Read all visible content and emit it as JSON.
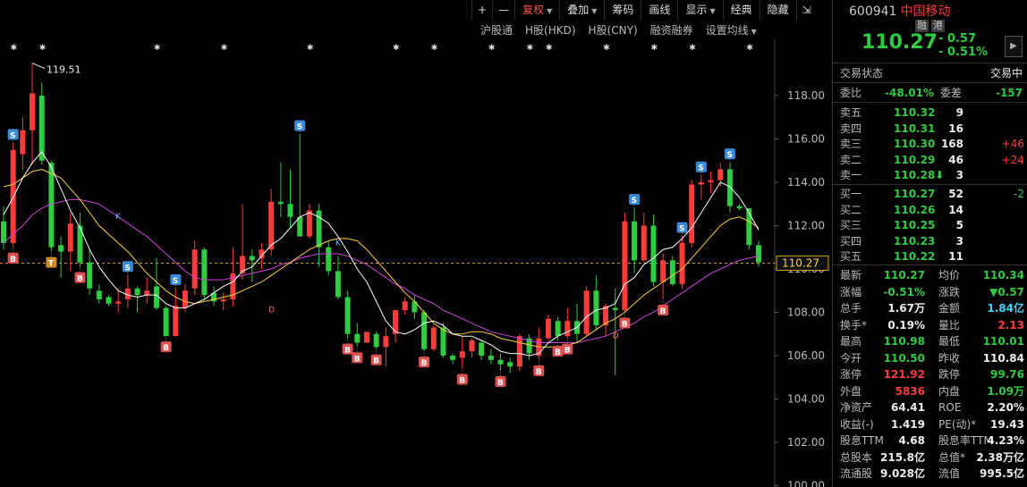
{
  "toolbar": {
    "plus": "+",
    "minus": "—",
    "items": [
      {
        "label": "复权",
        "dropdown": true,
        "active": true
      },
      {
        "label": "叠加",
        "dropdown": true,
        "active": false
      },
      {
        "label": "筹码",
        "dropdown": false,
        "active": false
      },
      {
        "label": "画线",
        "dropdown": false,
        "active": false
      },
      {
        "label": "显示",
        "dropdown": true,
        "active": false
      },
      {
        "label": "经典",
        "dropdown": false,
        "active": false
      },
      {
        "label": "隐藏",
        "dropdown": false,
        "active": false
      }
    ],
    "expand": "⇲"
  },
  "subbar": {
    "items": [
      "沪股通",
      "H股(HKD)",
      "H股(CNY)",
      "融资融券",
      "设置均线"
    ]
  },
  "chart": {
    "high_label": "119.51",
    "last_price_label": "110.27",
    "y_ticks": [
      "118.00",
      "116.00",
      "114.00",
      "112.00",
      "110.00",
      "108.00",
      "106.00",
      "104.00",
      "102.00",
      "100.00"
    ],
    "colors": {
      "up": "#ff3b3b",
      "down": "#2ecc40",
      "ma5": "#ffffff",
      "ma10": "#ffd23f",
      "ma20": "#d040e0",
      "price_line": "#d4a017"
    },
    "markers": {
      "S": "S",
      "B": "B",
      "T": "T",
      "D": "D",
      "K": "K"
    }
  },
  "chart_data": {
    "type": "candlestick",
    "ylim": [
      100,
      120
    ],
    "candles": [
      [
        112.2,
        112.9,
        110.9,
        111.2
      ],
      [
        111.2,
        115.8,
        111.0,
        115.5
      ],
      [
        115.3,
        117.0,
        114.6,
        116.4
      ],
      [
        116.4,
        119.5,
        114.8,
        118.1
      ],
      [
        118.0,
        118.6,
        114.8,
        115.0
      ],
      [
        114.9,
        115.0,
        110.8,
        111.0
      ],
      [
        111.1,
        111.5,
        109.6,
        110.8
      ],
      [
        110.8,
        112.6,
        109.9,
        112.1
      ],
      [
        112.0,
        112.6,
        110.1,
        110.3
      ],
      [
        110.3,
        110.9,
        108.8,
        109.1
      ],
      [
        109.0,
        109.3,
        108.4,
        108.6
      ],
      [
        108.7,
        108.8,
        108.3,
        108.4
      ],
      [
        108.4,
        109.1,
        108.0,
        108.5
      ],
      [
        108.6,
        109.7,
        108.2,
        109.1
      ],
      [
        109.1,
        109.2,
        108.0,
        108.8
      ],
      [
        108.8,
        109.6,
        108.4,
        109.0
      ],
      [
        109.2,
        110.5,
        108.1,
        108.2
      ],
      [
        108.2,
        108.3,
        106.9,
        106.9
      ],
      [
        106.9,
        109.1,
        106.9,
        108.3
      ],
      [
        108.2,
        109.3,
        108.0,
        109.0
      ],
      [
        109.1,
        111.3,
        108.8,
        110.9
      ],
      [
        110.9,
        111.0,
        108.6,
        108.8
      ],
      [
        108.9,
        109.2,
        108.3,
        108.5
      ],
      [
        108.5,
        108.9,
        108.1,
        108.6
      ],
      [
        108.6,
        111.0,
        108.3,
        109.8
      ],
      [
        109.8,
        113.0,
        109.5,
        110.6
      ],
      [
        110.6,
        110.9,
        109.4,
        110.4
      ],
      [
        110.5,
        111.2,
        110.0,
        110.9
      ],
      [
        110.9,
        113.7,
        110.6,
        113.1
      ],
      [
        113.1,
        114.9,
        112.4,
        113.0
      ],
      [
        113.0,
        114.6,
        111.9,
        112.4
      ],
      [
        112.4,
        116.2,
        111.9,
        111.5
      ],
      [
        111.5,
        113.0,
        111.4,
        112.7
      ],
      [
        112.7,
        113.0,
        110.1,
        111.0
      ],
      [
        111.0,
        111.3,
        109.7,
        109.9
      ],
      [
        109.9,
        110.6,
        108.6,
        108.7
      ],
      [
        108.7,
        109.0,
        106.8,
        107.0
      ],
      [
        107.0,
        107.5,
        106.4,
        106.6
      ],
      [
        106.6,
        107.1,
        106.6,
        107.1
      ],
      [
        107.0,
        107.1,
        106.3,
        106.4
      ],
      [
        106.4,
        107.3,
        105.5,
        106.9
      ],
      [
        107.0,
        108.1,
        106.6,
        108.1
      ],
      [
        108.1,
        108.7,
        107.9,
        108.5
      ],
      [
        108.5,
        108.8,
        107.7,
        108.0
      ],
      [
        108.0,
        108.1,
        106.2,
        106.3
      ],
      [
        106.3,
        107.4,
        106.2,
        107.3
      ],
      [
        107.3,
        107.5,
        105.9,
        106.0
      ],
      [
        106.0,
        106.1,
        105.6,
        105.8
      ],
      [
        105.9,
        106.9,
        105.4,
        106.2
      ],
      [
        106.2,
        106.8,
        105.9,
        106.7
      ],
      [
        106.6,
        106.7,
        105.8,
        106.0
      ],
      [
        106.0,
        106.3,
        105.6,
        105.8
      ],
      [
        105.8,
        106.1,
        105.3,
        105.6
      ],
      [
        105.7,
        105.9,
        105.2,
        105.5
      ],
      [
        105.5,
        107.0,
        105.3,
        106.9
      ],
      [
        106.8,
        107.0,
        105.8,
        106.1
      ],
      [
        106.0,
        107.3,
        105.8,
        106.8
      ],
      [
        106.8,
        107.9,
        106.7,
        107.7
      ],
      [
        107.6,
        107.8,
        106.7,
        106.9
      ],
      [
        106.9,
        108.2,
        106.8,
        107.6
      ],
      [
        107.6,
        108.4,
        106.6,
        107.0
      ],
      [
        107.0,
        109.2,
        106.9,
        109.0
      ],
      [
        109.0,
        109.7,
        107.2,
        107.4
      ],
      [
        107.4,
        108.4,
        106.9,
        108.3
      ],
      [
        108.2,
        109.1,
        105.1,
        108.1
      ],
      [
        108.1,
        112.6,
        108.0,
        112.2
      ],
      [
        112.2,
        112.8,
        109.8,
        110.4
      ],
      [
        110.4,
        112.6,
        110.3,
        112.0
      ],
      [
        112.0,
        112.5,
        109.2,
        109.4
      ],
      [
        109.4,
        110.7,
        108.6,
        110.4
      ],
      [
        110.4,
        110.6,
        109.2,
        109.3
      ],
      [
        109.3,
        111.5,
        109.1,
        111.2
      ],
      [
        111.2,
        114.1,
        111.0,
        113.9
      ],
      [
        113.9,
        114.3,
        113.2,
        114.0
      ],
      [
        114.0,
        114.5,
        113.5,
        114.1
      ],
      [
        114.1,
        114.9,
        113.8,
        114.6
      ],
      [
        114.6,
        114.9,
        112.6,
        112.9
      ],
      [
        112.9,
        113.0,
        112.7,
        112.8
      ],
      [
        112.8,
        112.8,
        110.9,
        111.1
      ],
      [
        111.1,
        111.3,
        110.1,
        110.3
      ]
    ],
    "ma5": [
      112.5,
      113.3,
      114.2,
      114.9,
      115.4,
      114.7,
      113.7,
      112.7,
      111.9,
      110.9,
      110.1,
      109.5,
      109.0,
      108.8,
      108.7,
      108.8,
      108.8,
      108.4,
      108.2,
      108.2,
      108.4,
      108.6,
      108.9,
      109.2,
      109.4,
      109.9,
      110.1,
      110.6,
      111.1,
      111.4,
      111.9,
      112.4,
      112.6,
      112.4,
      112.1,
      111.5,
      110.8,
      110.0,
      109.4,
      108.5,
      107.6,
      107.1,
      107.0,
      107.2,
      107.5,
      107.6,
      107.4,
      107.0,
      106.9,
      106.9,
      106.7,
      106.5,
      106.2,
      106.1,
      106.1,
      106.0,
      106.1,
      106.6,
      106.9,
      107.1,
      107.3,
      107.8,
      108.1,
      108.2,
      108.4,
      109.3,
      109.6,
      110.2,
      110.5,
      110.9,
      111.0,
      111.4,
      111.9,
      112.6,
      113.3,
      114.0,
      113.8,
      113.3,
      112.6,
      111.8
    ],
    "ma10": [
      113.8,
      113.9,
      114.2,
      114.5,
      114.6,
      114.4,
      114.2,
      113.7,
      113.2,
      112.6,
      112.0,
      111.6,
      111.2,
      110.8,
      110.3,
      109.8,
      109.4,
      109.0,
      108.7,
      108.5,
      108.4,
      108.5,
      108.6,
      108.7,
      108.8,
      109.0,
      109.2,
      109.4,
      109.7,
      110.0,
      110.3,
      110.6,
      110.9,
      111.1,
      111.3,
      111.4,
      111.4,
      111.3,
      110.9,
      110.4,
      109.9,
      109.4,
      108.9,
      108.5,
      108.0,
      107.5,
      107.2,
      107.0,
      107.0,
      107.1,
      107.1,
      107.0,
      106.8,
      106.7,
      106.6,
      106.5,
      106.4,
      106.4,
      106.4,
      106.5,
      106.6,
      106.9,
      107.2,
      107.5,
      107.7,
      108.0,
      108.4,
      108.8,
      109.1,
      109.4,
      109.7,
      110.0,
      110.5,
      111.0,
      111.5,
      112.0,
      112.3,
      112.4,
      112.2,
      111.9
    ],
    "ma20": [
      111.2,
      111.6,
      112.0,
      112.5,
      112.8,
      113.0,
      113.1,
      113.2,
      113.2,
      113.1,
      113.0,
      112.7,
      112.4,
      112.1,
      111.8,
      111.5,
      111.1,
      110.7,
      110.3,
      109.9,
      109.6,
      109.5,
      109.5,
      109.5,
      109.6,
      109.7,
      109.8,
      109.9,
      110.0,
      110.2,
      110.3,
      110.5,
      110.6,
      110.7,
      110.7,
      110.7,
      110.6,
      110.4,
      110.2,
      109.9,
      109.6,
      109.3,
      109.1,
      108.8,
      108.6,
      108.4,
      108.1,
      107.9,
      107.7,
      107.5,
      107.3,
      107.1,
      107.0,
      106.9,
      106.8,
      106.7,
      106.6,
      106.6,
      106.6,
      106.6,
      106.6,
      106.7,
      106.8,
      106.9,
      107.1,
      107.3,
      107.5,
      107.8,
      108.0,
      108.3,
      108.6,
      108.9,
      109.2,
      109.5,
      109.8,
      110.0,
      110.2,
      110.4,
      110.5,
      110.6
    ],
    "last_price": 110.27
  },
  "quote": {
    "code": "600941",
    "name": "中国移动",
    "tags": [
      "融",
      "港"
    ],
    "price": "110.27",
    "change": "- 0.57",
    "change_pct": "- 0.51%",
    "status_label": "交易状态",
    "status_value": "交易中",
    "weibi_label": "委比",
    "weibi_value": "-48.01%",
    "weicha_label": "委差",
    "weicha_value": "-157"
  },
  "asks": [
    {
      "label": "卖五",
      "price": "110.32",
      "vol": "9",
      "delta": ""
    },
    {
      "label": "卖四",
      "price": "110.31",
      "vol": "16",
      "delta": ""
    },
    {
      "label": "卖三",
      "price": "110.30",
      "vol": "168",
      "delta": "+46"
    },
    {
      "label": "卖二",
      "price": "110.29",
      "vol": "46",
      "delta": "+24"
    },
    {
      "label": "卖一",
      "price": "110.28⬇",
      "vol": "3",
      "delta": ""
    }
  ],
  "bids": [
    {
      "label": "买一",
      "price": "110.27",
      "vol": "52",
      "delta": "-2"
    },
    {
      "label": "买二",
      "price": "110.26",
      "vol": "14",
      "delta": ""
    },
    {
      "label": "买三",
      "price": "110.25",
      "vol": "5",
      "delta": ""
    },
    {
      "label": "买四",
      "price": "110.23",
      "vol": "3",
      "delta": ""
    },
    {
      "label": "买五",
      "price": "110.22",
      "vol": "11",
      "delta": ""
    }
  ],
  "stats": [
    {
      "l1": "最新",
      "v1": "110.27",
      "c1": "green",
      "l2": "均价",
      "v2": "110.34",
      "c2": "green"
    },
    {
      "l1": "涨幅",
      "v1": "-0.51%",
      "c1": "green",
      "l2": "涨跌",
      "v2": "▼0.57",
      "c2": "green"
    },
    {
      "l1": "总手",
      "v1": "1.67万",
      "c1": "white",
      "l2": "金额",
      "v2": "1.84亿",
      "c2": "cyan"
    },
    {
      "l1": "换手*",
      "v1": "0.19%",
      "c1": "white",
      "l2": "量比",
      "v2": "2.13",
      "c2": "red"
    },
    {
      "l1": "最高",
      "v1": "110.98",
      "c1": "green",
      "l2": "最低",
      "v2": "110.01",
      "c2": "green"
    },
    {
      "l1": "今开",
      "v1": "110.50",
      "c1": "green",
      "l2": "昨收",
      "v2": "110.84",
      "c2": "white"
    },
    {
      "l1": "涨停",
      "v1": "121.92",
      "c1": "red",
      "l2": "跌停",
      "v2": "99.76",
      "c2": "green"
    },
    {
      "l1": "外盘",
      "v1": "5836",
      "c1": "red",
      "l2": "内盘",
      "v2": "1.09万",
      "c2": "green"
    },
    {
      "l1": "净资产",
      "v1": "64.41",
      "c1": "white",
      "l2": "ROE",
      "v2": "2.20%",
      "c2": "white"
    },
    {
      "l1": "收益(-)",
      "v1": "1.419",
      "c1": "white",
      "l2": "PE(动)*",
      "v2": "19.43",
      "c2": "white"
    },
    {
      "l1": "股息TTM",
      "v1": "4.68",
      "c1": "white",
      "l2": "股息率TTM",
      "v2": "4.23%",
      "c2": "white"
    },
    {
      "l1": "总股本",
      "v1": "215.8亿",
      "c1": "white",
      "l2": "总值*",
      "v2": "2.38万亿",
      "c2": "white"
    },
    {
      "l1": "流通股",
      "v1": "9.028亿",
      "c1": "white",
      "l2": "流值",
      "v2": "995.5亿",
      "c2": "white"
    }
  ]
}
